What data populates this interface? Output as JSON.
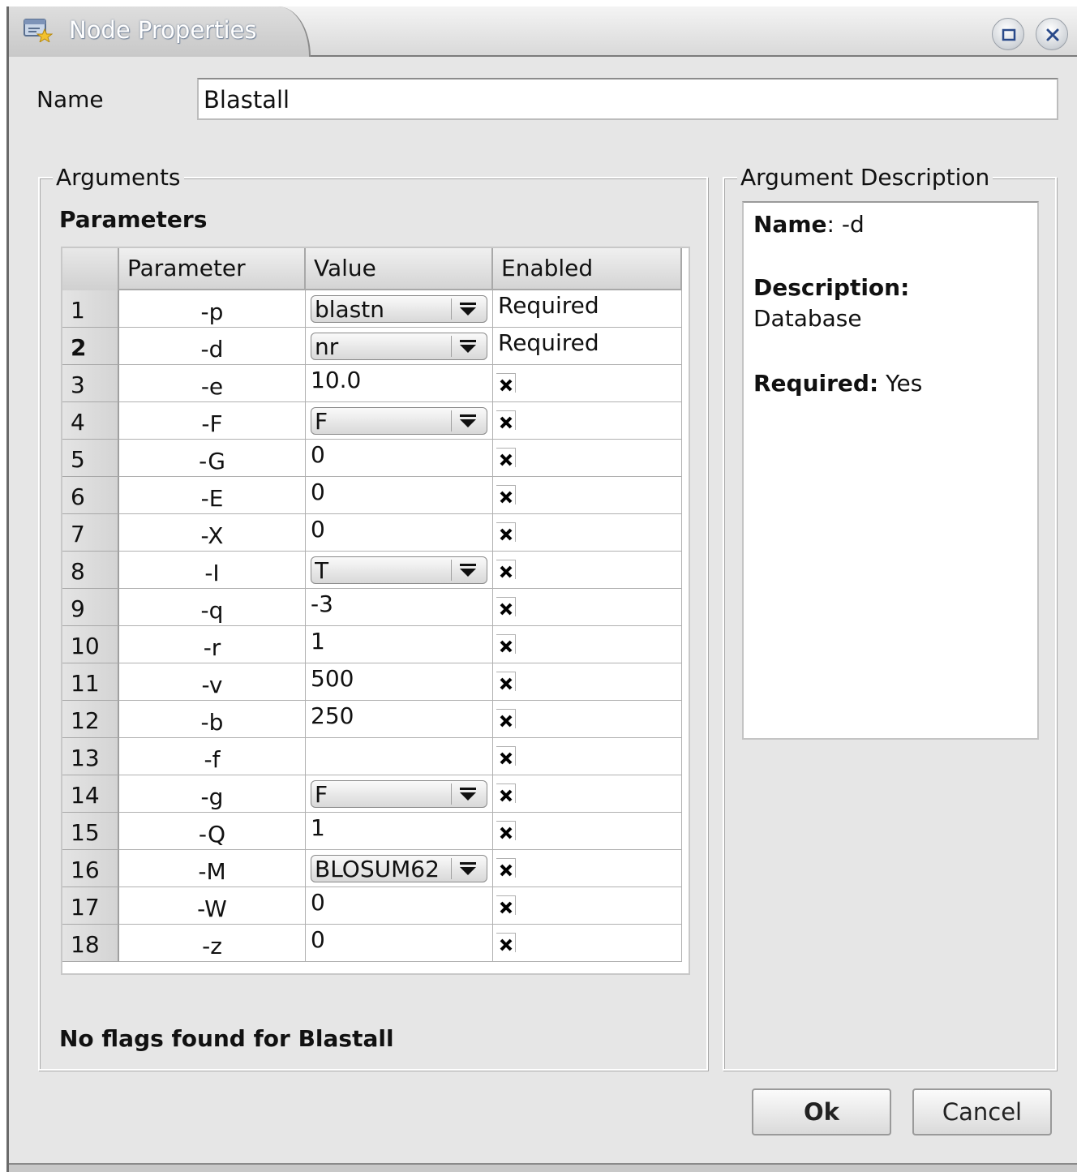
{
  "window": {
    "title": "Node Properties",
    "buttons": {
      "maximize": "maximize-icon",
      "close": "close-icon"
    }
  },
  "name_field": {
    "label": "Name",
    "value": "Blastall"
  },
  "arguments": {
    "group_title": "Arguments",
    "section_label": "Parameters",
    "columns": [
      "Parameter",
      "Value",
      "Enabled"
    ],
    "rows": [
      {
        "num": "1",
        "param": "-p",
        "value": "blastn",
        "type": "combo",
        "enabled": "Required"
      },
      {
        "num": "2",
        "param": "-d",
        "value": "nr",
        "type": "combo",
        "enabled": "Required",
        "selected": true
      },
      {
        "num": "3",
        "param": "-e",
        "value": "10.0",
        "type": "text",
        "enabled": "check"
      },
      {
        "num": "4",
        "param": "-F",
        "value": "F",
        "type": "combo",
        "enabled": "check"
      },
      {
        "num": "5",
        "param": "-G",
        "value": "0",
        "type": "text",
        "enabled": "check"
      },
      {
        "num": "6",
        "param": "-E",
        "value": "0",
        "type": "text",
        "enabled": "check"
      },
      {
        "num": "7",
        "param": "-X",
        "value": "0",
        "type": "text",
        "enabled": "check"
      },
      {
        "num": "8",
        "param": "-I",
        "value": "T",
        "type": "combo",
        "enabled": "check"
      },
      {
        "num": "9",
        "param": "-q",
        "value": "-3",
        "type": "text",
        "enabled": "check"
      },
      {
        "num": "10",
        "param": "-r",
        "value": "1",
        "type": "text",
        "enabled": "check"
      },
      {
        "num": "11",
        "param": "-v",
        "value": "500",
        "type": "text",
        "enabled": "check"
      },
      {
        "num": "12",
        "param": "-b",
        "value": "250",
        "type": "text",
        "enabled": "check"
      },
      {
        "num": "13",
        "param": "-f",
        "value": "",
        "type": "text",
        "enabled": "check"
      },
      {
        "num": "14",
        "param": "-g",
        "value": "F",
        "type": "combo",
        "enabled": "check"
      },
      {
        "num": "15",
        "param": "-Q",
        "value": "1",
        "type": "text",
        "enabled": "check"
      },
      {
        "num": "16",
        "param": "-M",
        "value": "BLOSUM62",
        "type": "combo",
        "enabled": "check"
      },
      {
        "num": "17",
        "param": "-W",
        "value": "0",
        "type": "text",
        "enabled": "check"
      },
      {
        "num": "18",
        "param": "-z",
        "value": "0",
        "type": "text",
        "enabled": "check"
      }
    ],
    "flags_message": "No flags found for Blastall"
  },
  "argument_description": {
    "group_title": "Argument Description",
    "name_label": "Name",
    "name_value": ": -d",
    "description_label": "Description:",
    "description_value": "Database",
    "required_label": "Required:",
    "required_value": "Yes"
  },
  "buttons": {
    "ok": "Ok",
    "cancel": "Cancel"
  }
}
